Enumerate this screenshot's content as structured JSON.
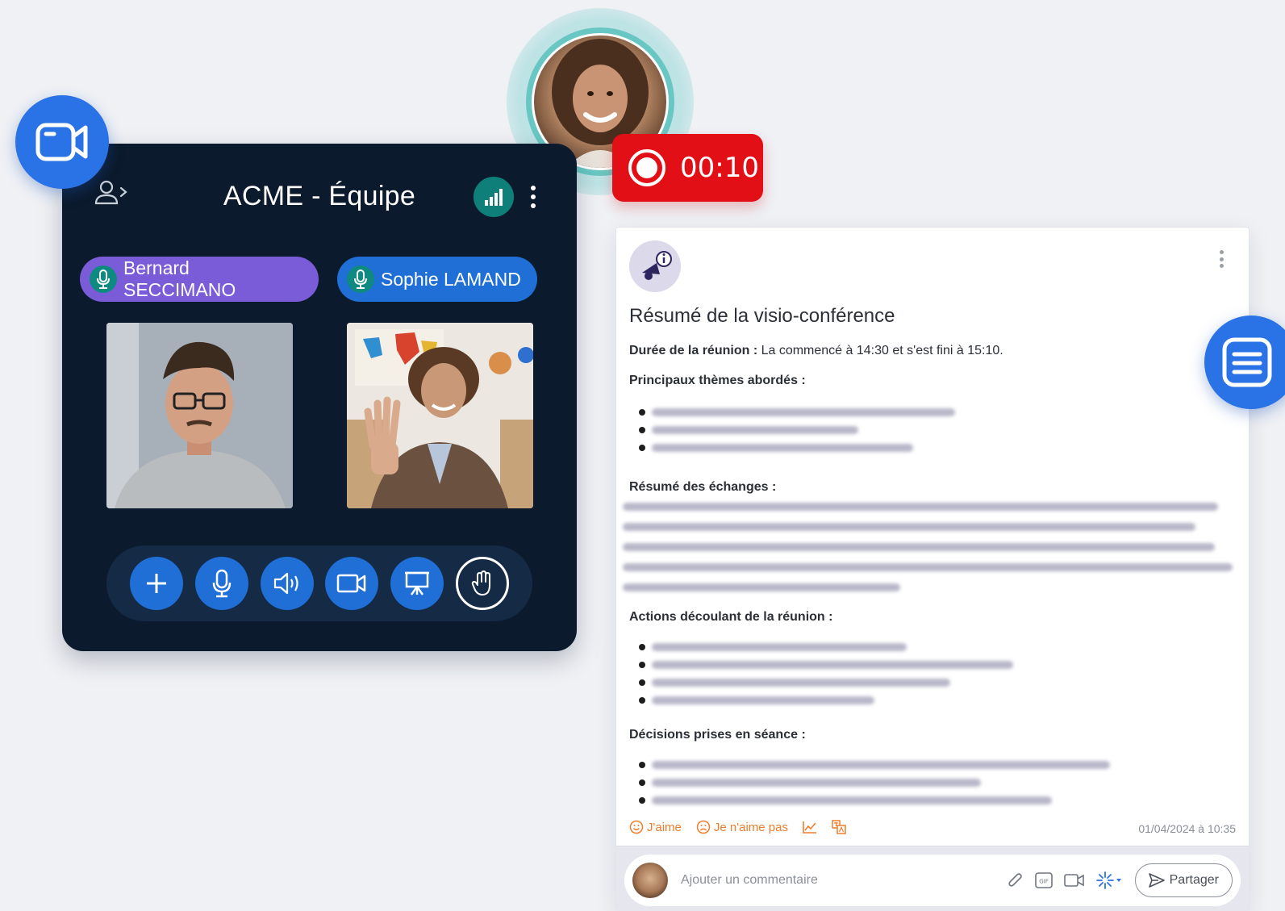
{
  "call": {
    "title": "ACME  - Équipe",
    "participants": [
      {
        "name": "Bernard SECCIMANO",
        "color": "#7a5bd8"
      },
      {
        "name": "Sophie LAMAND",
        "color": "#1f6fd6"
      }
    ],
    "controls": [
      "plus-icon",
      "microphone-icon",
      "speaker-icon",
      "camera-icon",
      "presentation-icon",
      "raise-hand-icon"
    ]
  },
  "recording": {
    "time": "00:10",
    "color": "#e30f16"
  },
  "summary": {
    "title": "Résumé de la visio-conférence",
    "duration_label": "Durée de la réunion :",
    "duration_text": " La commencé à 14:30 et s'est fini à 15:10.",
    "themes_heading": "Principaux thèmes abordés :",
    "exchanges_heading": "Résumé des échanges :",
    "actions_heading": "Actions découlant de la réunion :",
    "decisions_heading": "Décisions prises en séance :",
    "like_label": "J'aime",
    "dislike_label": "Je n'aime pas",
    "timestamp": "01/04/2024 à 10:35",
    "comment_placeholder": "Ajouter un commentaire",
    "share_label": "Partager"
  },
  "colors": {
    "accent": "#2a73e6",
    "panel": "#0b1a2c",
    "reaction": "#ef7d2b"
  }
}
